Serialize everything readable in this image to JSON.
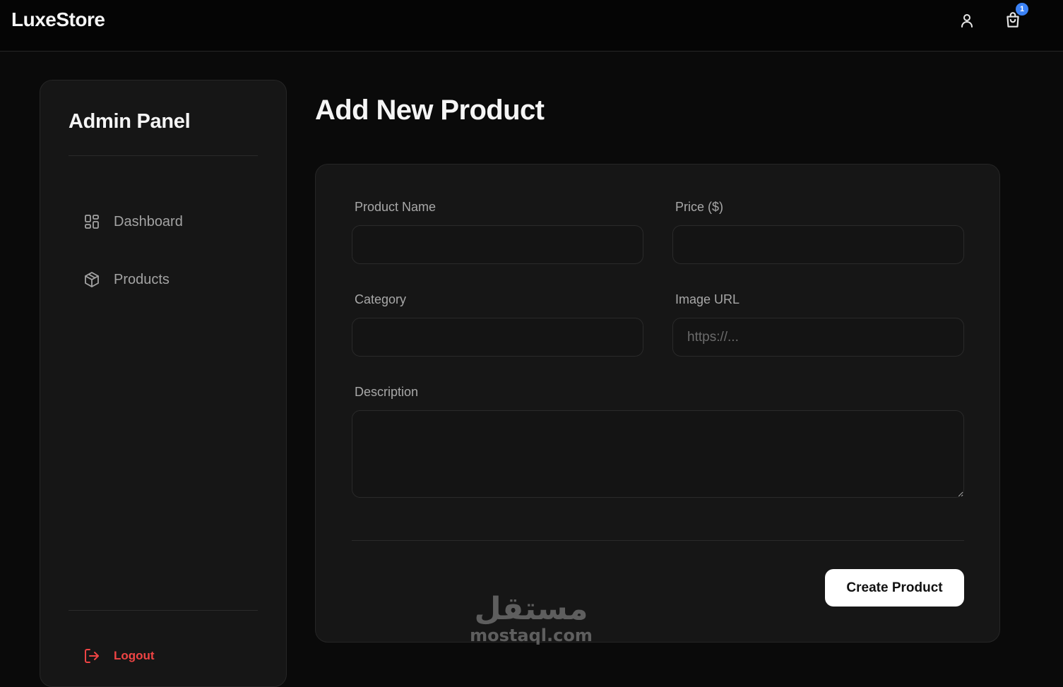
{
  "header": {
    "brand": "LuxeStore",
    "cart_count": "1",
    "badge_color": "#3b82f6"
  },
  "sidebar": {
    "title": "Admin Panel",
    "items": [
      {
        "label": "Dashboard",
        "icon": "grid-icon"
      },
      {
        "label": "Products",
        "icon": "box-icon"
      }
    ],
    "logout_label": "Logout",
    "logout_color": "#ef4444"
  },
  "main": {
    "title": "Add New Product",
    "form": {
      "product_name_label": "Product Name",
      "product_name_value": "",
      "price_label": "Price ($)",
      "price_value": "",
      "category_label": "Category",
      "category_value": "",
      "image_url_label": "Image URL",
      "image_url_placeholder": "https://...",
      "image_url_value": "",
      "description_label": "Description",
      "description_value": "",
      "submit_label": "Create Product"
    }
  },
  "watermark": {
    "arabic": "مستقل",
    "latin": "mostaql.com"
  }
}
